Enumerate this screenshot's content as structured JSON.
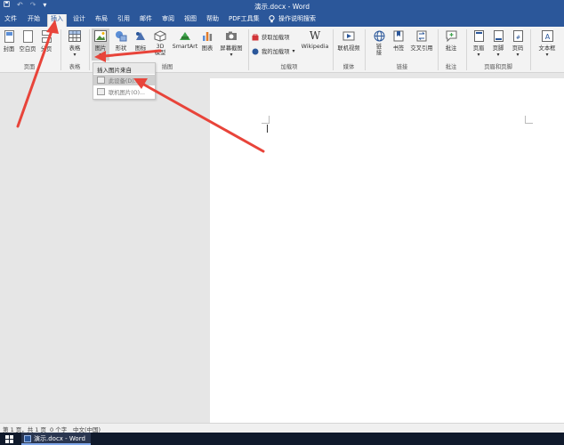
{
  "window": {
    "title": "演示.docx - Word"
  },
  "tabs": [
    {
      "label": "文件"
    },
    {
      "label": "开始"
    },
    {
      "label": "插入"
    },
    {
      "label": "设计"
    },
    {
      "label": "布局"
    },
    {
      "label": "引用"
    },
    {
      "label": "邮件"
    },
    {
      "label": "审阅"
    },
    {
      "label": "视图"
    },
    {
      "label": "帮助"
    },
    {
      "label": "PDF工具集"
    }
  ],
  "tell_me": "操作说明搜索",
  "ribbon": {
    "pages": {
      "cover": "封面",
      "blank": "空白页",
      "break": "分页",
      "group": "页面"
    },
    "tables": {
      "table": "表格",
      "group": "表格"
    },
    "illustrations": {
      "picture": "图片",
      "shapes": "形状",
      "icons": "图标",
      "model3d": "3D\n模型",
      "smartart": "SmartArt",
      "chart": "图表",
      "screenshot": "屏幕截图",
      "group": "插图"
    },
    "addins": {
      "get": "获取加载项",
      "mine": "我的加载项",
      "wikipedia": "Wikipedia",
      "group": "加载项"
    },
    "media": {
      "online_video": "联机视频",
      "group": "媒体"
    },
    "links": {
      "link": "链\n接",
      "bookmark": "书签",
      "crossref": "交叉引用",
      "group": "链接"
    },
    "comments": {
      "comment": "批注",
      "group": "批注"
    },
    "header_footer": {
      "header": "页眉",
      "footer": "页脚",
      "page_number": "页码",
      "group": "页眉和页脚"
    },
    "text": {
      "textbox": "文本框"
    }
  },
  "dropdown": {
    "header": "插入图片来自",
    "items": [
      {
        "label": "此设备(D)..."
      },
      {
        "label": "联机图片(O)..."
      }
    ]
  },
  "status": {
    "page": "第 1 页，共 1 页",
    "words": "0 个字",
    "language": "中文(中国)"
  },
  "taskbar": {
    "app_label": "演示.docx - Word"
  },
  "colors": {
    "accent": "#2b579a",
    "arrow": "#e8443a"
  }
}
